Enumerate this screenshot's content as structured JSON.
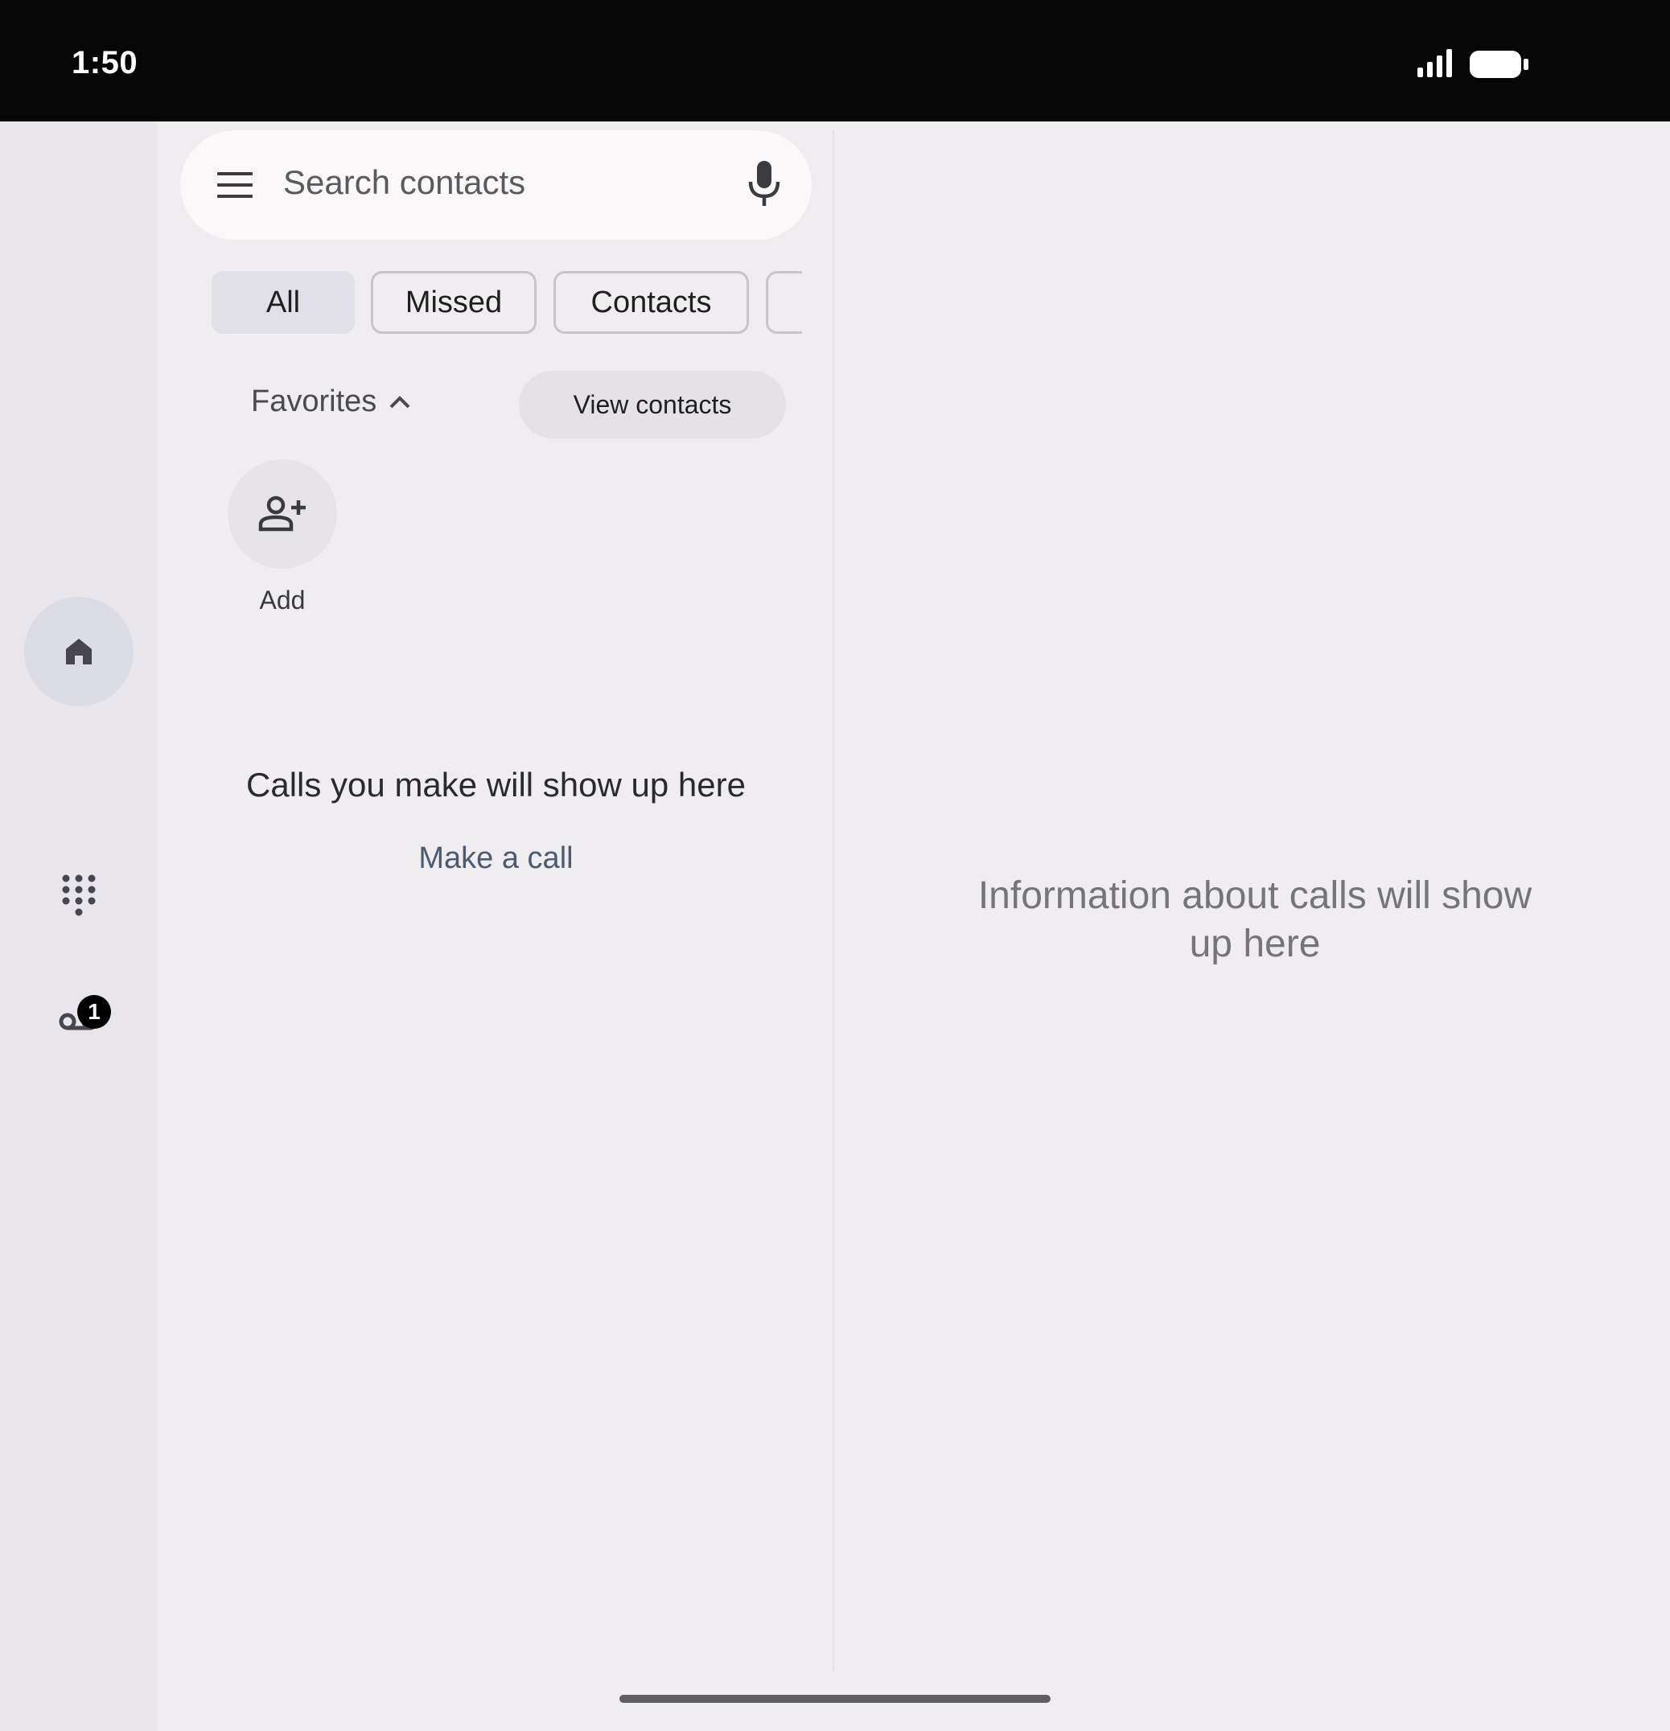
{
  "status_bar": {
    "time": "1:50",
    "signal_icon": "signal-icon",
    "battery_icon": "battery-icon"
  },
  "nav_rail": {
    "items": [
      {
        "icon": "home-icon",
        "active": true
      },
      {
        "icon": "dialpad-icon",
        "active": false
      },
      {
        "icon": "voicemail-icon",
        "active": false,
        "badge": "1"
      }
    ]
  },
  "search": {
    "menu_icon": "menu-icon",
    "placeholder": "Search contacts",
    "mic_icon": "mic-icon"
  },
  "filters": {
    "chips": [
      {
        "label": "All",
        "selected": true
      },
      {
        "label": "Missed",
        "selected": false
      },
      {
        "label": "Contacts",
        "selected": false
      },
      {
        "label": "",
        "selected": false
      }
    ]
  },
  "favorites": {
    "label": "Favorites",
    "view_contacts": "View contacts",
    "add_label": "Add",
    "add_icon": "person-add-icon"
  },
  "call_log": {
    "empty_title": "Calls you make will show up here",
    "make_call": "Make a call"
  },
  "detail_pane": {
    "placeholder": "Information about calls will show up here"
  },
  "colors": {
    "background": "#efedef",
    "rail_background": "#e8e6ea",
    "chip_selected": "#e0e0e6",
    "status_bar": "#060606",
    "badge": "#000000"
  }
}
